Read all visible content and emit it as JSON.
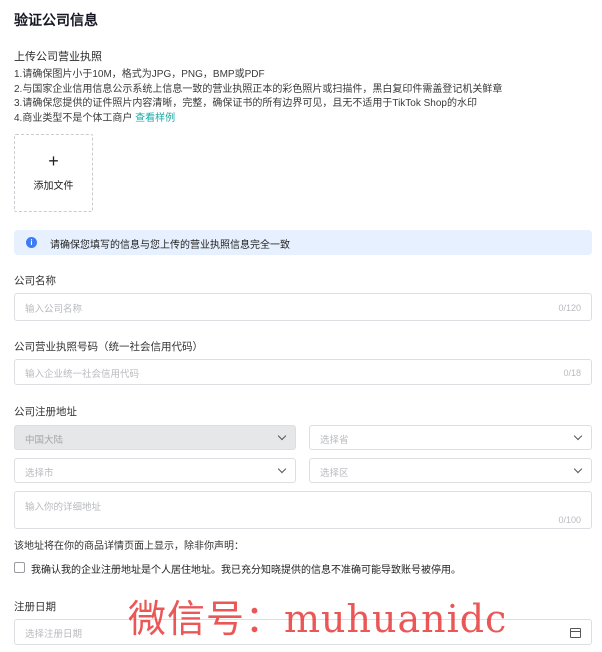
{
  "title": "验证公司信息",
  "upload_section": {
    "heading": "上传公司营业执照",
    "rules": [
      "1.请确保图片小于10M，格式为JPG，PNG，BMP或PDF",
      "2.与国家企业信用信息公示系统上信息一致的营业执照正本的彩色照片或扫描件，黑白复印件需盖登记机关鲜章",
      "3.请确保您提供的证件照片内容清晰，完整，确保证书的所有边界可见，且无不适用于TikTok Shop的水印",
      "4.商业类型不是个体工商户"
    ],
    "sample_link": "查看样例",
    "upload_plus": "+",
    "upload_label": "添加文件"
  },
  "banner": {
    "icon": "info-icon",
    "icon_glyph": "i",
    "text": "请确保您填写的信息与您上传的营业执照信息完全一致",
    "color": "#e6f0fe"
  },
  "company_name": {
    "label": "公司名称",
    "placeholder": "输入公司名称",
    "counter": "0/120"
  },
  "license_number": {
    "label": "公司营业执照号码（统一社会信用代码）",
    "placeholder": "输入企业统一社会信用代码",
    "counter": "0/18"
  },
  "address": {
    "label": "公司注册地址",
    "country": "中国大陆",
    "province_placeholder": "选择省",
    "city_placeholder": "选择市",
    "district_placeholder": "选择区",
    "detail_placeholder": "输入你的详细地址",
    "detail_counter": "0/100",
    "note": "该地址将在你的商品详情页面上显示，除非你声明：",
    "checkbox_text": "我确认我的企业注册地址是个人居住地址。我已充分知晓提供的信息不准确可能导致账号被停用。"
  },
  "registration_date": {
    "label": "注册日期",
    "placeholder": "选择注册日期",
    "icon": "calendar-icon"
  },
  "watermark": "微信号：muhuanidc",
  "colors": {
    "accent_link": "#1aa9a5",
    "info_icon": "#3d7bf6",
    "watermark": "#e62828"
  }
}
